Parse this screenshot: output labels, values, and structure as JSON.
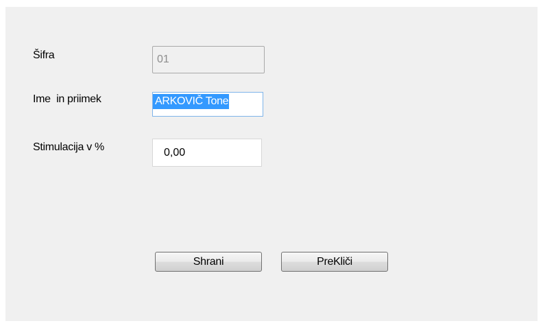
{
  "form": {
    "sifra": {
      "label": "Šifra",
      "value": "01",
      "enabled": false
    },
    "ime_priimek": {
      "label": "Ime  in priimek",
      "value": "ARKOVIČ Tone",
      "text_selected": true
    },
    "stimulacija": {
      "label": "Stimulacija v %",
      "value": "0,00"
    }
  },
  "buttons": {
    "save_label": "Shrani",
    "cancel_label": "PreKliči"
  },
  "colors": {
    "panel_background": "#f0f0f0",
    "selection_highlight": "#3399ff"
  }
}
